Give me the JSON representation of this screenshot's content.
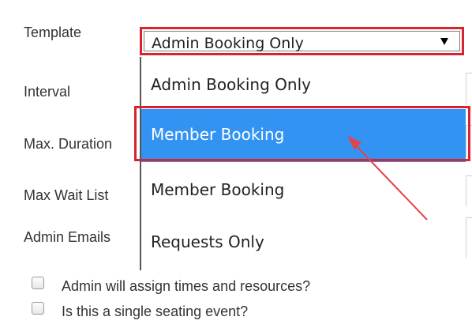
{
  "form": {
    "labels": {
      "template": "Template",
      "interval": "Interval",
      "max_duration": "Max. Duration",
      "max_wait_list": "Max Wait List",
      "admin_emails": "Admin Emails"
    },
    "template_select": {
      "selected_value": "Admin Booking Only",
      "options": [
        {
          "label": "Admin Booking Only",
          "highlighted": false
        },
        {
          "label": "Member Booking",
          "highlighted": true
        },
        {
          "label": "Member Booking",
          "highlighted": false
        },
        {
          "label": "Requests Only",
          "highlighted": false
        }
      ]
    },
    "checkboxes": [
      {
        "label": "Admin will assign times and resources?",
        "checked": false
      },
      {
        "label": "Is this a single seating event?",
        "checked": false
      }
    ]
  },
  "colors": {
    "highlight": "#3393f3",
    "annotation_red": "#d9232e",
    "arrow_red": "#e0454f"
  },
  "icons": {
    "dropdown_arrow": "triangle-down-icon",
    "annotation": "arrow-pointer-annotation"
  }
}
